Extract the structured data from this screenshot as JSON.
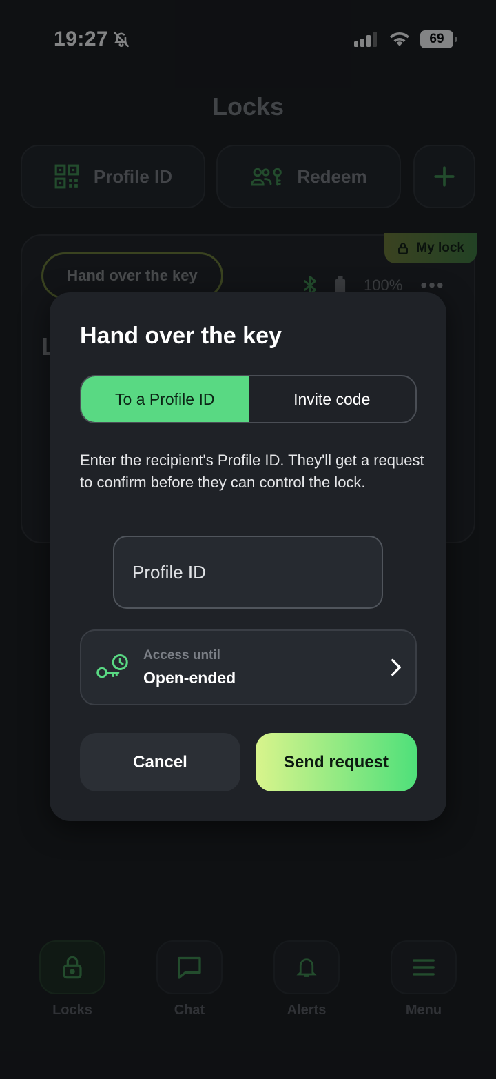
{
  "status_bar": {
    "time": "19:27",
    "battery": "69"
  },
  "header": {
    "title": "Locks"
  },
  "quick_actions": {
    "profile_id_label": "Profile ID",
    "redeem_label": "Redeem"
  },
  "lock_card": {
    "badge": "My lock",
    "handover_label": "Hand over the key",
    "battery": "100%",
    "name_initial": "L"
  },
  "modal": {
    "title": "Hand over the key",
    "tabs": [
      "To a Profile ID",
      "Invite code"
    ],
    "active_tab": "To a Profile ID",
    "description": "Enter the recipient's Profile ID. They'll get a request to confirm before they can control the lock.",
    "profile_input": {
      "placeholder": "Profile ID",
      "value": ""
    },
    "access": {
      "label": "Access until",
      "value": "Open-ended"
    },
    "cancel_label": "Cancel",
    "send_label": "Send request"
  },
  "nav": {
    "items": [
      "Locks",
      "Chat",
      "Alerts",
      "Menu"
    ],
    "active": "Locks"
  },
  "colors": {
    "accent_green": "#59d983",
    "gradient_start": "#d9f48c",
    "gradient_end": "#4fe07a",
    "background": "#16181b"
  }
}
